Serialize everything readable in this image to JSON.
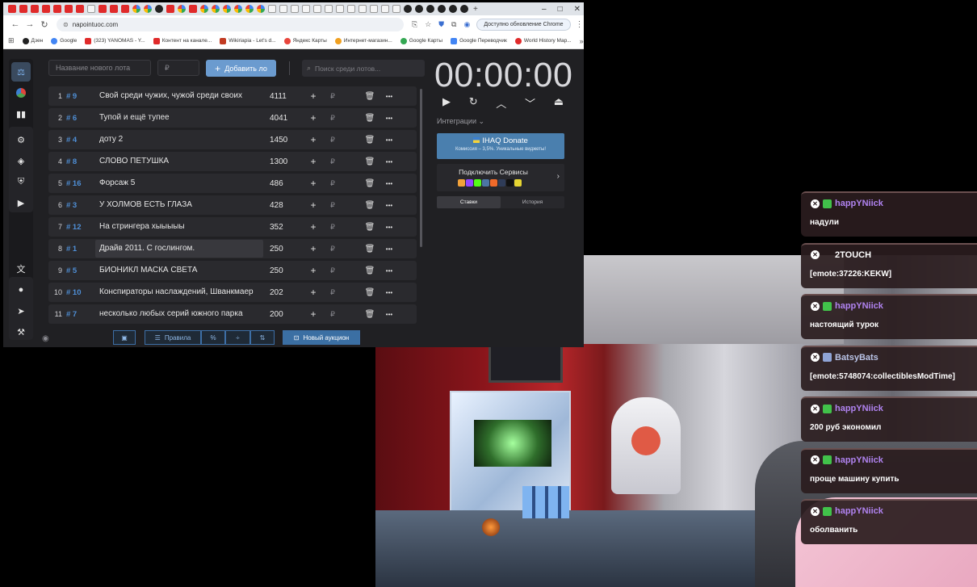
{
  "browser": {
    "url": "napointuoc.com",
    "update_button": "Доступно обновление Chrome",
    "bookmarks": [
      {
        "label": "Дзен",
        "color": "#222222"
      },
      {
        "label": "Google",
        "color": "#4285f4"
      },
      {
        "label": "(323) YANOMAS - Y...",
        "color": "#e02a2a"
      },
      {
        "label": "Контент на канале...",
        "color": "#e02a2a"
      },
      {
        "label": "Wikiriapia - Let's d...",
        "color": "#c23b22"
      },
      {
        "label": "Яндекс Карты",
        "color": "#e8453c"
      },
      {
        "label": "Интернет-магазин...",
        "color": "#f0a020"
      },
      {
        "label": "Google Карты",
        "color": "#34a853"
      },
      {
        "label": "Google Переводчик",
        "color": "#4285f4"
      },
      {
        "label": "World History Map...",
        "color": "#e02a2a"
      }
    ],
    "tabs_more": "»"
  },
  "app": {
    "new_lot_placeholder": "Название нового лота",
    "amount_placeholder": "₽",
    "add_lot_label": "Добавить ло",
    "search_placeholder": "Поиск среди лотов...",
    "lots": [
      {
        "index": "1",
        "id": "# 9",
        "name": "Свой среди чужих, чужой среди своих",
        "amount": "4111"
      },
      {
        "index": "2",
        "id": "# 6",
        "name": "Тупой и ещё тупее",
        "amount": "4041"
      },
      {
        "index": "3",
        "id": "# 4",
        "name": "доту 2",
        "amount": "1450"
      },
      {
        "index": "4",
        "id": "# 8",
        "name": "СЛОВО ПЕТУШКА",
        "amount": "1300"
      },
      {
        "index": "5",
        "id": "# 16",
        "name": "Форсаж 5",
        "amount": "486"
      },
      {
        "index": "6",
        "id": "# 3",
        "name": "У ХОЛМОВ ЕСТЬ ГЛАЗА",
        "amount": "428"
      },
      {
        "index": "7",
        "id": "# 12",
        "name": "На стрингера хыыыыы",
        "amount": "352"
      },
      {
        "index": "8",
        "id": "# 1",
        "name": "Драйв 2011. С гослингом.",
        "amount": "250"
      },
      {
        "index": "9",
        "id": "# 5",
        "name": "БИОНИКЛ МАСКА СВЕТА",
        "amount": "250"
      },
      {
        "index": "10",
        "id": "# 10",
        "name": "Конспираторы наслаждений, Шванкмаер",
        "amount": "202"
      },
      {
        "index": "11",
        "id": "# 7",
        "name": "несколько любых серий южного парка",
        "amount": "200"
      }
    ],
    "row_plus": "+",
    "row_rub": "₽",
    "row_trash": "🗑",
    "row_more": "•••",
    "bottom": {
      "rules": "Правила",
      "percent": "%",
      "divide": "÷",
      "sort": "⇅",
      "new_auction": "Новый аукцион"
    },
    "timer": "00:00:00",
    "integrations": "Интеграции",
    "donate": {
      "title": "IHAQ Donate",
      "subtitle": "Комиссия – 3,5%. Уникальные виджеты!"
    },
    "services_title": "Подключить Сервисы",
    "tabs": {
      "bids": "Ставки",
      "history": "История"
    }
  },
  "chat": [
    {
      "user": "happYNiick",
      "color": "#b083f0",
      "text": "надули"
    },
    {
      "user": "2TOUCH",
      "color": "#ffffff",
      "text": "[emote:37226:KEKW]"
    },
    {
      "user": "happYNiick",
      "color": "#b083f0",
      "text": "настоящий турок"
    },
    {
      "user": "BatsyBats",
      "color": "#b9c3e6",
      "text": "[emote:5748074:collectiblesModTime]"
    },
    {
      "user": "happYNiick",
      "color": "#b083f0",
      "text": "200 руб экономил"
    },
    {
      "user": "happYNiick",
      "color": "#b083f0",
      "text": "проще машину купить"
    },
    {
      "user": "happYNiick",
      "color": "#b083f0",
      "text": "оболванить"
    }
  ]
}
